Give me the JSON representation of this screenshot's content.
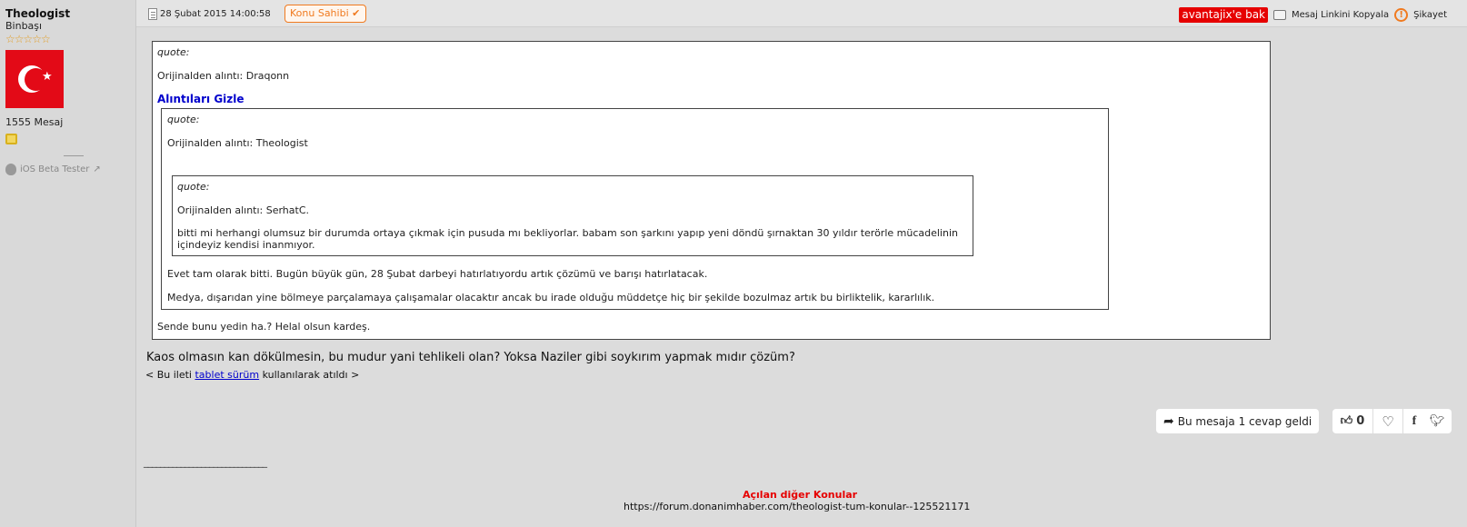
{
  "user": {
    "name": "Theologist",
    "rank": "Binbaşı",
    "stars": "☆☆☆☆☆",
    "message_count": "1555 Mesaj",
    "beta_label": "iOS Beta Tester"
  },
  "header": {
    "date": "28 Şubat 2015 14:00:58",
    "owner_badge": "Konu Sahibi",
    "avantaj_label": "avantajix'e bak",
    "copy_link_label": "Mesaj Linkini Kopyala",
    "report_label": "Şikayet"
  },
  "quotes": {
    "outer": {
      "label": "quote:",
      "source": "Orijinalden alıntı: Draqonn",
      "hide_label": "Alıntıları Gizle",
      "reply": "Sende bunu yedin ha.? Helal olsun kardeş."
    },
    "middle": {
      "label": "quote:",
      "source": "Orijinalden alıntı: Theologist",
      "text1": "Evet tam olarak bitti. Bugün büyük gün, 28 Şubat darbeyi hatırlatıyordu artık çözümü ve barışı hatırlatacak.",
      "text2": "Medya, dışarıdan yine bölmeye parçalamaya çalışamalar olacaktır ancak bu irade olduğu müddetçe hiç bir şekilde bozulmaz artık bu birliktelik, kararlılık."
    },
    "inner": {
      "label": "quote:",
      "source": "Orijinalden alıntı: SerhatC.",
      "text_line1": "bitti mi herhangi olumsuz bir durumda ortaya çıkmak için pusuda mı bekliyorlar. babam son şarkını yapıp yeni döndü şırnaktan 30 yıldır terörle mücadelinin",
      "text_line2": "içindeyiz kendisi inanmıyor."
    }
  },
  "post": {
    "main_text": "Kaos olmasın kan dökülmesin, bu mudur yani tehlikeli olan? Yoksa Naziler gibi soykırım yapmak mıdır çözüm?",
    "sent_prefix": "< Bu ileti ",
    "sent_link": "tablet sürüm",
    "sent_suffix": " kullanılarak atıldı >"
  },
  "actions": {
    "reply_count_label": "Bu mesaja 1 cevap geldi",
    "like_count": "0"
  },
  "signature": {
    "line": "______________________________",
    "other_topics_title": "Açılan diğer Konular",
    "other_topics_url": "https://forum.donanimhaber.com/theologist-tum-konular--125521171"
  }
}
